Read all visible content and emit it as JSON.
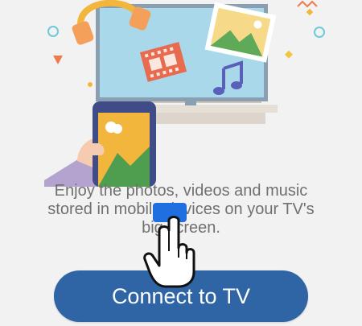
{
  "intro": {
    "description": "Enjoy the photos, videos and music stored in mobile devices on your TV's big screen.",
    "connect_label": "Connect to TV"
  },
  "illustration": {
    "icons": [
      "headphones-icon",
      "tv-icon",
      "film-strip-icon",
      "music-note-icon",
      "photo-icon",
      "smartphone-icon",
      "hand-icon"
    ]
  },
  "colors": {
    "background": "#f2f2f2",
    "button": "#2f64a5",
    "text": "#707070",
    "overlay_marker": "#1f6fe0"
  }
}
